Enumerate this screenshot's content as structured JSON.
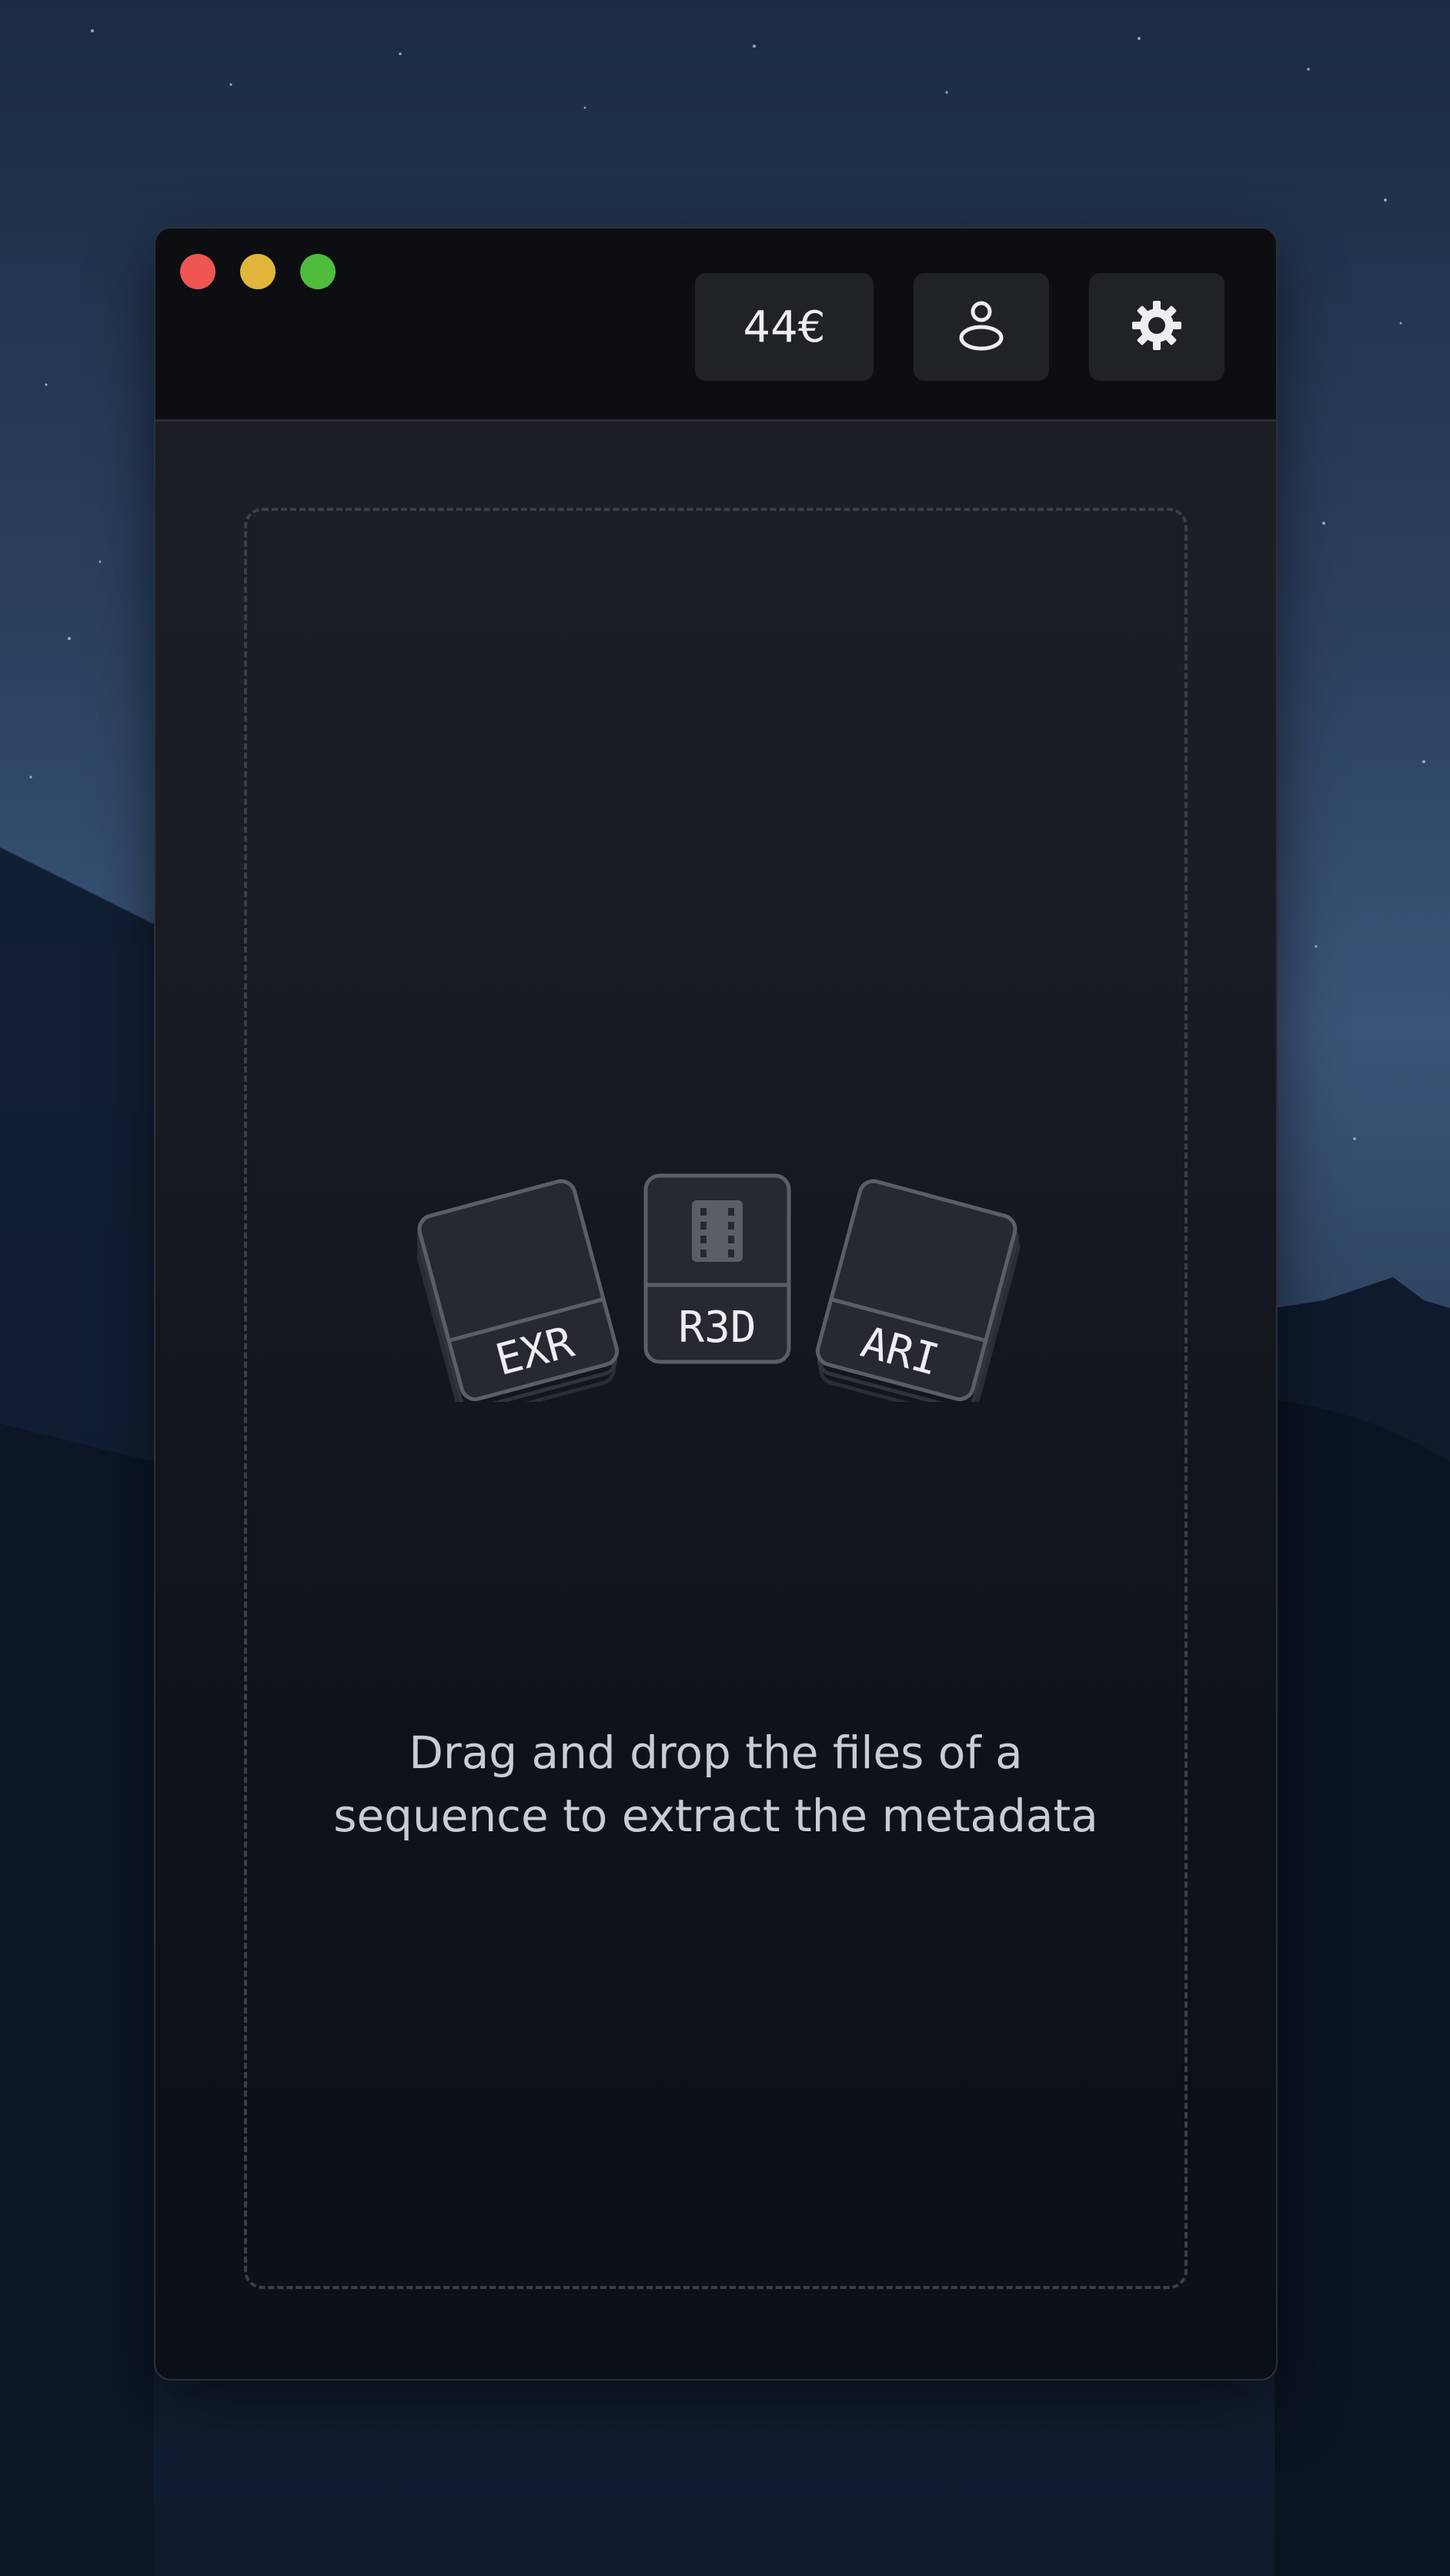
{
  "window": {
    "traffic_lights": [
      "close",
      "minimize",
      "zoom"
    ],
    "toolbar": {
      "price_label": "44€",
      "account_icon": "user-icon",
      "settings_icon": "gear-icon"
    }
  },
  "dropzone": {
    "file_types": [
      "EXR",
      "R3D",
      "ARI"
    ],
    "center_icon": "film-icon",
    "message_line1": "Drag and drop the files of a",
    "message_line2": "sequence to extract the metadata"
  },
  "colors": {
    "close": "#ef5551",
    "minimize": "#e1b53b",
    "zoom": "#4fbc3c",
    "titlebar": "#0c0e12",
    "button_bg": "#1f2227",
    "dashed_border": "#3a3e45",
    "text": "#c9ccd1"
  }
}
